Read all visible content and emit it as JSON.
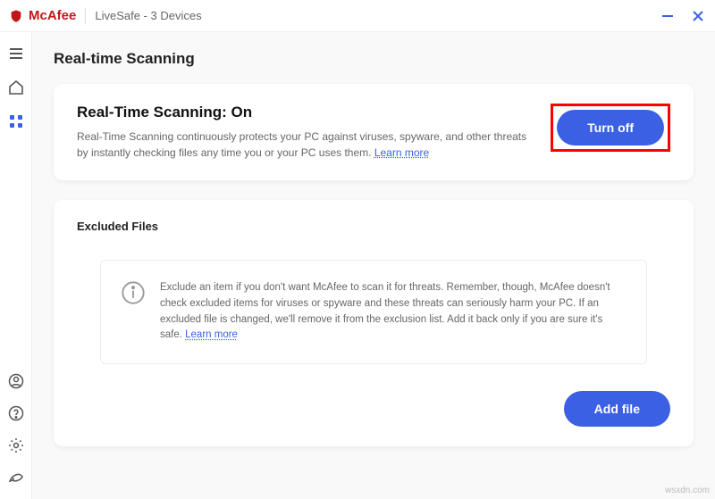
{
  "brand": {
    "name": "McAfee",
    "product": "LiveSafe - 3 Devices"
  },
  "page": {
    "title": "Real-time Scanning"
  },
  "scan_card": {
    "title": "Real-Time Scanning: On",
    "desc": "Real-Time Scanning continuously protects your PC against viruses, spyware, and other threats by instantly checking files any time you or your PC uses them. ",
    "learn_more": "Learn more",
    "button": "Turn off"
  },
  "excluded": {
    "title": "Excluded Files",
    "info": "Exclude an item if you don't want McAfee to scan it for threats. Remember, though, McAfee doesn't check excluded items for viruses or spyware and these threats can seriously harm your PC. If an excluded file is changed, we'll remove it from the exclusion list. Add it back only if you are sure it's safe. ",
    "learn_more": "Learn more",
    "button": "Add file"
  },
  "watermark": "wsxdn.com"
}
